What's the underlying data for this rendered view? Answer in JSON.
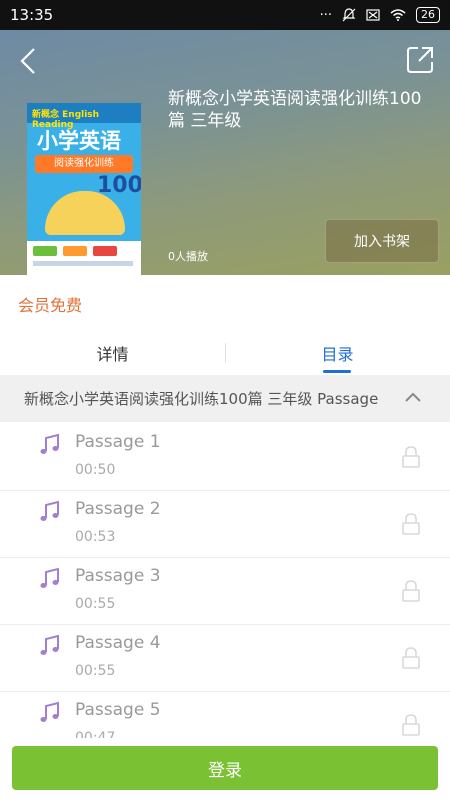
{
  "status_bar": {
    "time": "13:35",
    "battery": "26"
  },
  "header": {
    "title": "新概念小学英语阅读强化训练100篇   三年级",
    "play_count": "0人播放",
    "add_to_shelf": "加入书架"
  },
  "cover": {
    "series": "新概念 English Reading",
    "main_title": "小学英语",
    "subtitle": "阅读强化训练",
    "number": "100"
  },
  "member_label": "会员免费",
  "tabs": {
    "details": "详情",
    "catalog": "目录"
  },
  "catalog": {
    "header": "新概念小学英语阅读强化训练100篇   三年级 Passage",
    "items": [
      {
        "title": "Passage 1",
        "duration": "00:50"
      },
      {
        "title": "Passage 2",
        "duration": "00:53"
      },
      {
        "title": "Passage 3",
        "duration": "00:55"
      },
      {
        "title": "Passage 4",
        "duration": "00:55"
      },
      {
        "title": "Passage 5",
        "duration": "00:47"
      }
    ]
  },
  "login_button": "登录",
  "colors": {
    "accent_blue": "#1f6fd8",
    "member_orange": "#e2723a",
    "login_green": "#7ac133",
    "note_purple": "#a27fd1"
  },
  "icons": [
    "back-icon",
    "share-icon",
    "music-note-icon",
    "lock-icon",
    "chevron-up-icon"
  ]
}
